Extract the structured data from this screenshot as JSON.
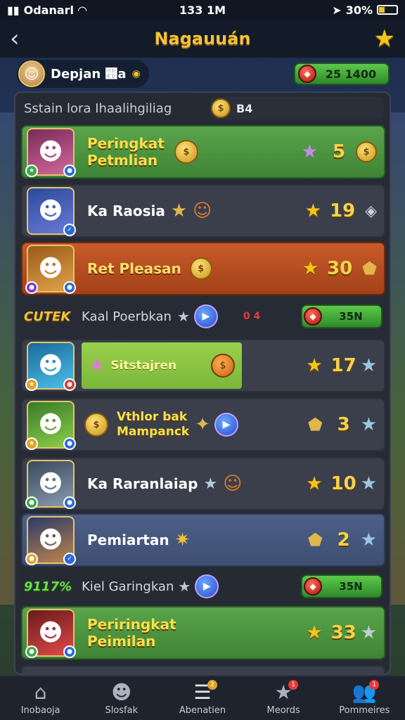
{
  "status_bar": {
    "carrier": "Odanarl",
    "time": "133 1M",
    "battery": "30%"
  },
  "header": {
    "title": "Nagauuán"
  },
  "profile": {
    "name": "Depjan ෽a",
    "currency_value": "25 1400"
  },
  "panel": {
    "subtitle": "Sstain lora  Ihaalihgiliag",
    "coin_value": "B4"
  },
  "rows": [
    {
      "name_line1": "Peringkat",
      "name_line2": "Petmlian",
      "score": "5"
    },
    {
      "name": "Ka Raosia",
      "score": "19"
    },
    {
      "name": "Ret Pleasan",
      "score": "30"
    },
    {
      "name": "Sitstajren",
      "score": "17"
    },
    {
      "name_line1": "Vthlor bak",
      "name_line2": "Mampanck",
      "score": "3"
    },
    {
      "name": "Ka Raranlaiap",
      "score": "10"
    },
    {
      "name": "Pemiartan",
      "score": "2"
    },
    {
      "name_line1": "Periringkat",
      "name_line2": "Peimilan",
      "score": "33"
    }
  ],
  "separators": [
    {
      "badge": "CUTEK",
      "text": "Kaal Poerbkan",
      "small": "0  4",
      "value": "35N"
    },
    {
      "badge": "9117%",
      "text": "Kiel Garingkan",
      "value": "35N"
    }
  ],
  "bottom_nav": [
    {
      "label": "Inobaoja"
    },
    {
      "label": "Slosfak"
    },
    {
      "label": "Abenatien",
      "badge": "2"
    },
    {
      "label": "Meords",
      "badge": "1"
    },
    {
      "label": "Pommeires",
      "badge": "1"
    }
  ],
  "colors": {
    "accent_gold": "#f2c23a",
    "row_green": "#5aa44a",
    "row_orange": "#c85a2a",
    "row_dark": "#3a3f4b",
    "row_blue": "#4c5f86",
    "currency_green": "#5cc94a"
  }
}
